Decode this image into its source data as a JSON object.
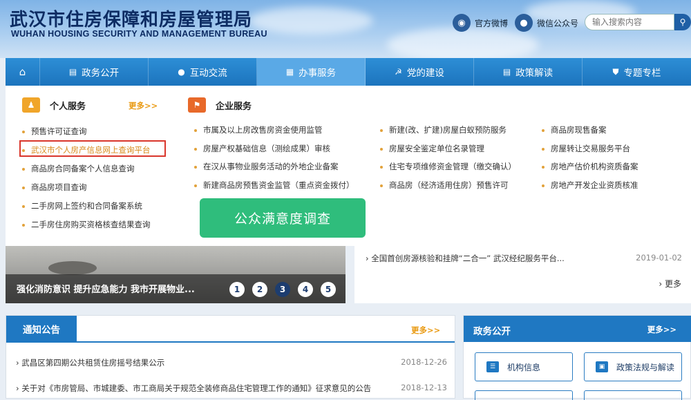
{
  "header": {
    "title_cn": "武汉市住房保障和房屋管理局",
    "title_en": "WUHAN HOUSING SECURITY AND MANAGEMENT BUREAU",
    "weibo_label": "官方微博",
    "wechat_label": "微信公众号",
    "search_placeholder": "输入搜索内容"
  },
  "nav": {
    "home_icon": "home-icon",
    "items": [
      {
        "label": "政务公开",
        "icon": "document-icon"
      },
      {
        "label": "互动交流",
        "icon": "chat-icon"
      },
      {
        "label": "办事服务",
        "icon": "grid-icon",
        "active": true
      },
      {
        "label": "党的建设",
        "icon": "party-icon"
      },
      {
        "label": "政策解读",
        "icon": "document-icon"
      },
      {
        "label": "专题专栏",
        "icon": "shield-icon"
      }
    ]
  },
  "personal": {
    "title": "个人服务",
    "more": "更多>>",
    "items": [
      "预售许可证查询",
      "武汉市个人房产信息网上查询平台",
      "商品房合同备案个人信息查询",
      "商品房项目查询",
      "二手房网上签约和合同备案系统",
      "二手房住房购买资格核查结果查询"
    ]
  },
  "enterprise": {
    "title": "企业服务",
    "col1": [
      "市属及以上房改售房资金使用监管",
      "房屋产权基础信息（测绘成果）审核",
      "在汉从事物业服务活动的外地企业备案",
      "新建商品房预售资金监管（重点资金拨付）"
    ],
    "col2": [
      "新建(改、扩建)房屋白蚁预防服务",
      "房屋安全鉴定单位名录管理",
      "住宅专项维修资金管理（缴交确认）",
      "商品房（经济适用住房）预售许可"
    ],
    "col3": [
      "商品房现售备案",
      "房屋转让交易服务平台",
      "房地产估价机构资质备案",
      "房地产开发企业资质核准"
    ]
  },
  "survey_button": "公众满意度调查",
  "slider": {
    "caption": "强化消防意识 提升应急能力 我市开展物业...",
    "pages": [
      "1",
      "2",
      "3",
      "4",
      "5"
    ],
    "active_page": "3"
  },
  "news": {
    "item": "全国首创房源核验和挂牌“二合一” 武汉经纪服务平台...",
    "date": "2019-01-02",
    "more": "更多"
  },
  "notice": {
    "title": "通知公告",
    "more": "更多>>",
    "rows": [
      {
        "text": "武昌区第四期公共租赁住房摇号结果公示",
        "date": "2018-12-26"
      },
      {
        "text": "关于对《市房管局、市城建委、市工商局关于规范全装修商品住宅管理工作的通知》征求意见的公告",
        "date": "2018-12-13"
      }
    ]
  },
  "gov": {
    "title": "政务公开",
    "more": "更多>>",
    "buttons": [
      "机构信息",
      "政策法规与解读"
    ]
  }
}
